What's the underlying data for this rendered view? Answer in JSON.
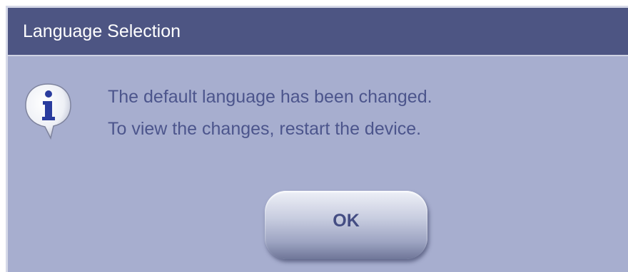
{
  "dialog": {
    "title": "Language Selection",
    "message_lines": [
      "The default language has been changed.",
      "To view the changes, restart the device."
    ],
    "ok_label": "OK",
    "icon": "info-icon"
  },
  "colors": {
    "titlebar": "#4d5583",
    "body": "#a7aecf",
    "text": "#4c558c",
    "icon_letter": "#2a3c9e"
  }
}
